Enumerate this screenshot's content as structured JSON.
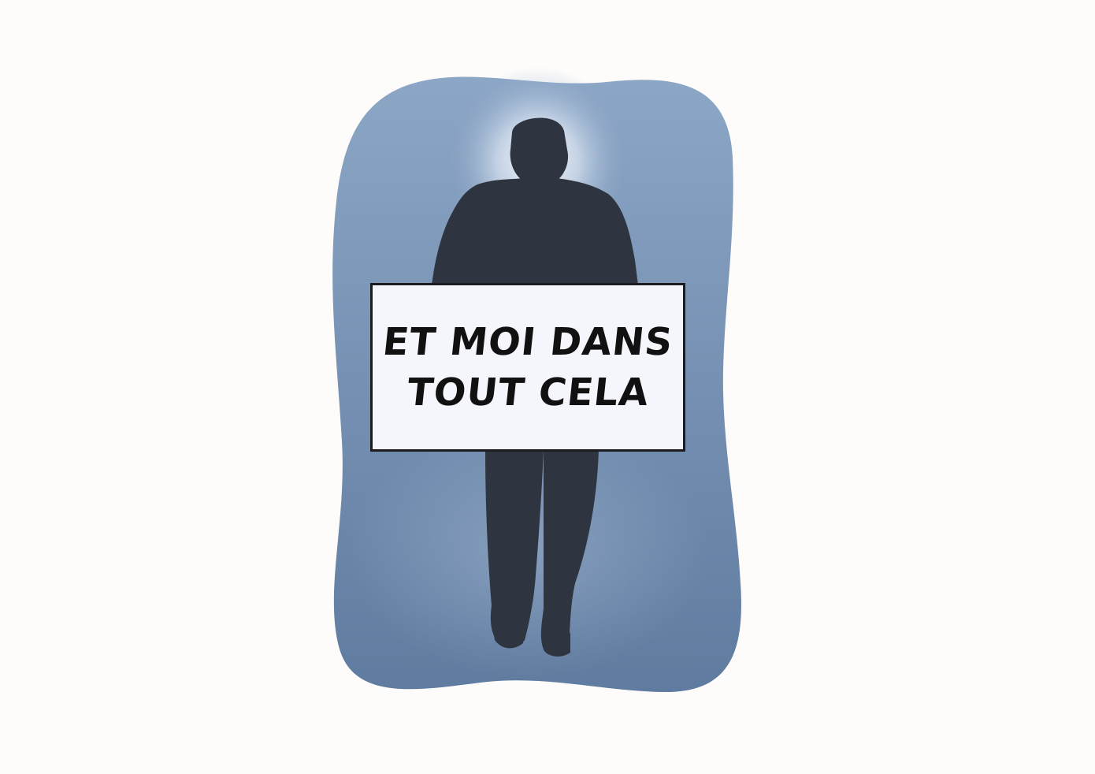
{
  "caption": {
    "line1": "ET MOI DANS",
    "line2": "TOUT CELA"
  },
  "colors": {
    "page_background": "#fdfcfb",
    "blob_top": "#8ca6c6",
    "blob_bottom": "#5f7b9f",
    "halo": "#ffffff",
    "silhouette": "#2f3540",
    "caption_fill": "#f4f6fb",
    "caption_border": "#1c1c1e",
    "caption_text": "#111111"
  },
  "icons": {
    "figure": "walking-man-silhouette-back-view"
  }
}
